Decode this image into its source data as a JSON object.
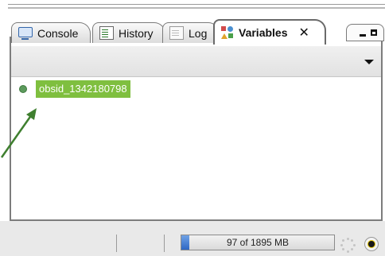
{
  "tabs": [
    {
      "label": "Console",
      "icon": "console-icon",
      "active": false
    },
    {
      "label": "History",
      "icon": "history-icon",
      "active": false
    },
    {
      "label": "Log",
      "icon": "log-icon",
      "active": false
    },
    {
      "label": "Variables",
      "icon": "variables-icon",
      "active": true,
      "close": "✕"
    }
  ],
  "variables": [
    {
      "name": "obsid_1342180798",
      "status_color": "#5c9a5c",
      "selected": true
    }
  ],
  "status": {
    "memory_text": "97 of 1895 MB",
    "memory_used_mb": 97,
    "memory_total_mb": 1895
  },
  "colors": {
    "selection": "#7fbf3f",
    "memory_bar": "#2e67c4",
    "annotation_arrow": "#3f7f2f"
  }
}
